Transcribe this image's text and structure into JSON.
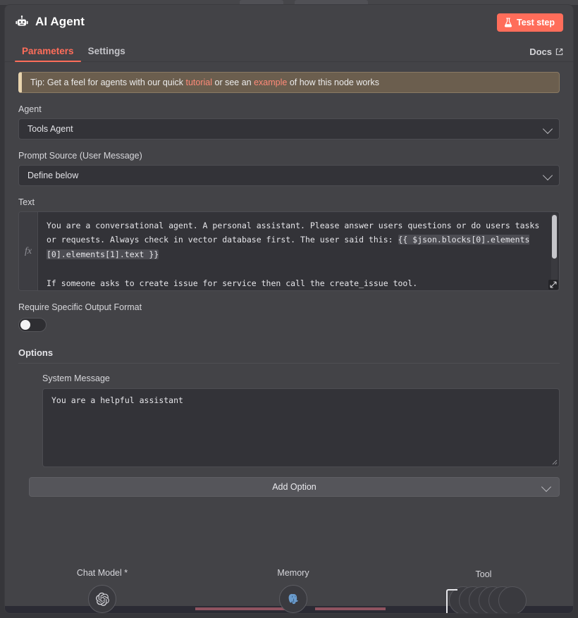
{
  "header": {
    "title": "AI Agent",
    "robot_icon": "robot-icon",
    "test_step_label": "Test step",
    "flask_icon": "flask-icon"
  },
  "tabs": [
    {
      "label": "Parameters",
      "active": true
    },
    {
      "label": "Settings",
      "active": false
    }
  ],
  "docs": {
    "label": "Docs",
    "icon": "external-link-icon"
  },
  "tip": {
    "prefix": "Tip: Get a feel for agents with our quick ",
    "link1": "tutorial",
    "middle": " or see an ",
    "link2": "example",
    "suffix": " of how this node works"
  },
  "agent": {
    "label": "Agent",
    "value": "Tools Agent"
  },
  "prompt_source": {
    "label": "Prompt Source (User Message)",
    "value": "Define below"
  },
  "text": {
    "label": "Text",
    "fx_glyph": "fx",
    "line1": "You are a conversational agent. A personal assistant. Please answer users questions or do users tasks or requests. Always check in vector database first. The user said this: ",
    "expression": "{{ $json.blocks[0].elements[0].elements[1].text }}",
    "line2": "If someone asks to create issue for service then call the create_issue tool."
  },
  "require_output_format": {
    "label": "Require Specific Output Format",
    "enabled": false
  },
  "options": {
    "heading": "Options",
    "system_message": {
      "label": "System Message",
      "value": "You are a helpful assistant"
    },
    "add_option_label": "Add Option"
  },
  "connectors": [
    {
      "label": "Chat Model *",
      "icon": "openai-icon"
    },
    {
      "label": "Memory",
      "icon": "postgres-icon"
    },
    {
      "label": "Tool",
      "icon": "tool-icon"
    }
  ],
  "colors": {
    "accent": "#ff6d5a",
    "panel": "#434347",
    "field": "#333338",
    "tip_bg": "#6b5e4e",
    "tip_border": "#e8d4ae"
  }
}
